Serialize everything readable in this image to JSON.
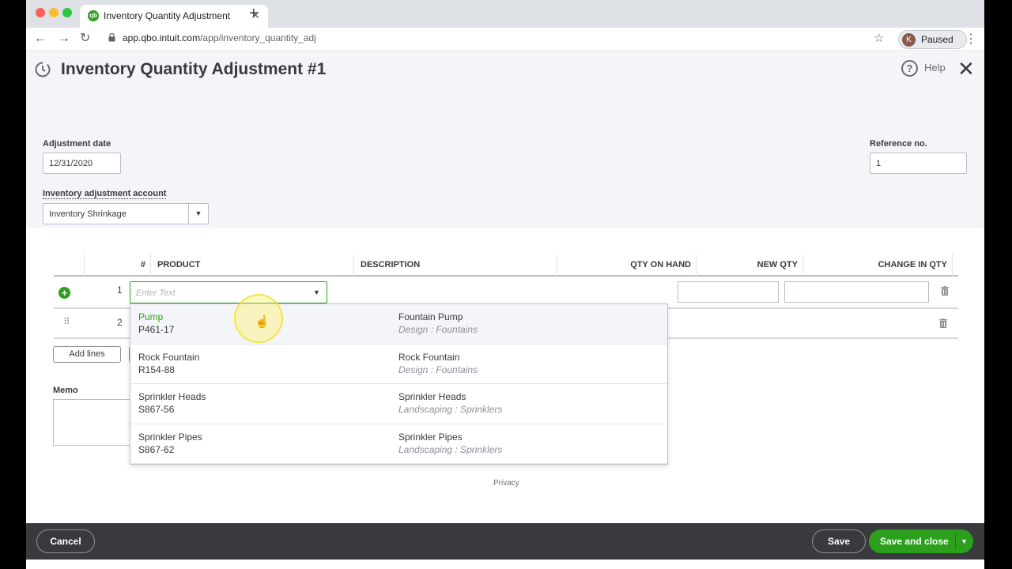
{
  "browser": {
    "tab_title": "Inventory Quantity Adjustment",
    "tab_close": "✕",
    "new_tab": "+",
    "url_host": "app.qbo.intuit.com",
    "url_path": "/app/inventory_quantity_adj",
    "profile_initial": "K",
    "profile_status": "Paused"
  },
  "header": {
    "title": "Inventory Quantity Adjustment #1",
    "help_label": "Help"
  },
  "form": {
    "date_label": "Adjustment date",
    "date_value": "12/31/2020",
    "reference_label": "Reference no.",
    "reference_value": "1",
    "account_label": "Inventory adjustment account",
    "account_value": "Inventory Shrinkage"
  },
  "table": {
    "headers": {
      "num": "#",
      "product": "PRODUCT",
      "description": "DESCRIPTION",
      "qty_on_hand": "QTY ON HAND",
      "new_qty": "NEW QTY",
      "change_in_qty": "CHANGE IN QTY"
    },
    "rows": [
      {
        "num": "1"
      },
      {
        "num": "2"
      }
    ],
    "product_placeholder": "Enter Text",
    "add_lines": "Add lines"
  },
  "dropdown": {
    "items": [
      {
        "name": "Pump",
        "sku": "P461-17",
        "description": "Fountain Pump",
        "category": "Design : Fountains"
      },
      {
        "name": "Rock Fountain",
        "sku": "R154-88",
        "description": "Rock Fountain",
        "category": "Design : Fountains"
      },
      {
        "name": "Sprinkler Heads",
        "sku": "S867-56",
        "description": "Sprinkler Heads",
        "category": "Landscaping : Sprinklers"
      },
      {
        "name": "Sprinkler Pipes",
        "sku": "S867-62",
        "description": "Sprinkler Pipes",
        "category": "Landscaping : Sprinklers"
      }
    ]
  },
  "memo": {
    "label": "Memo"
  },
  "privacy": "Privacy",
  "side_marker": "2",
  "footer": {
    "cancel": "Cancel",
    "save": "Save",
    "save_and_close": "Save and close"
  },
  "colors": {
    "brand_green": "#2ca01c",
    "footer_bg": "#393a3d",
    "header_bg": "#f4f5f8"
  },
  "icons": {
    "history": "history-icon",
    "help": "help-icon",
    "close": "close-icon",
    "trash": "trash-icon",
    "add": "add-line-icon"
  }
}
